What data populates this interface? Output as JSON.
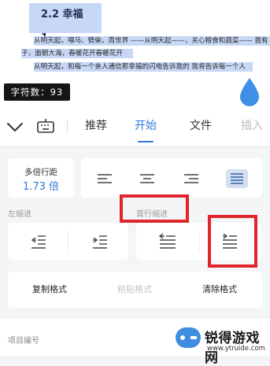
{
  "document": {
    "heading": "2.2  幸福1",
    "lines": [
      "从明天起，喂马、劈柴，周世界 ——从明天起——，关心粮食和蔬菜—— 我有",
      "子，面朝大海，春暖花开春暖花开",
      "从明天起，和每一个亲人通信那幸福的闪电告诉我的  我将告诉每一个人"
    ],
    "char_count": "字符数：93"
  },
  "tabs": {
    "items": [
      "推荐",
      "开始",
      "文件",
      "插入"
    ],
    "active": "开始"
  },
  "paragraph": {
    "line_spacing_label": "多倍行距",
    "line_spacing_value": "1.73 倍",
    "left_indent_label": "左缩进",
    "first_line_indent_label": "首行缩进"
  },
  "format": {
    "copy_label": "复制格式",
    "paste_label": "粘贴格式",
    "clear_label": "清除格式"
  },
  "list": {
    "numbering_label": "项目编号"
  },
  "watermark": {
    "name": "锐得游戏网",
    "url": "www.ytruide.com"
  },
  "colors": {
    "accent": "#2e7bd9",
    "selection": "#c7d8f7",
    "highlight_box": "#e0262b",
    "drop": "#3f8fe6"
  }
}
